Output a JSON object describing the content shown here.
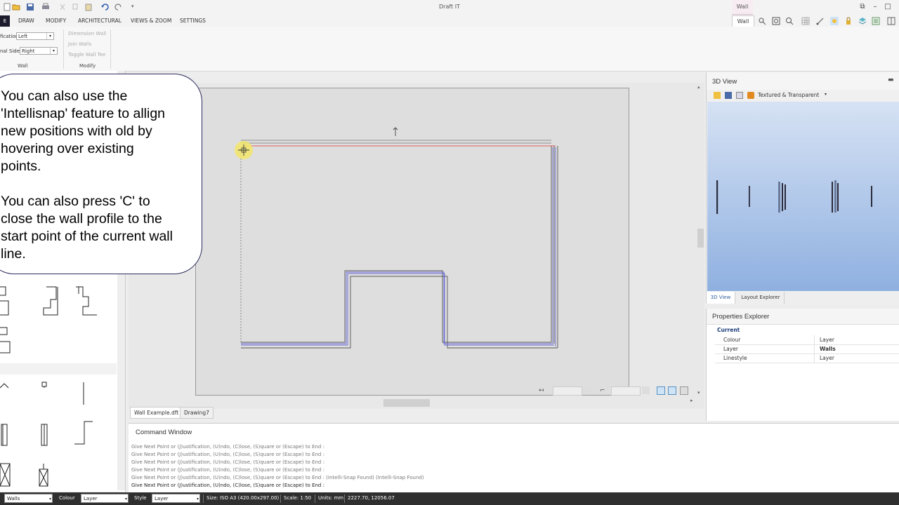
{
  "app": {
    "title": "Draft IT"
  },
  "window_controls": {
    "minimize": "–",
    "maximize": "□",
    "close": "✕",
    "restore_ribbon": "⧉",
    "help": "?"
  },
  "context_tab": {
    "caption": "Wall",
    "tab_label": "Wall"
  },
  "ribbon_tabs": [
    "DRAW",
    "MODIFY",
    "ARCHITECTURAL",
    "VIEWS & ZOOM",
    "SETTINGS"
  ],
  "file_tab": "E",
  "ribbon": {
    "justification_label": "fication",
    "justification_value": "Left",
    "additional_side_label": "nal Side",
    "additional_side_value": "Right",
    "wall_group": "Wall",
    "modify_group": "Modify",
    "modify_items": [
      "Dimension Wall",
      "Join Walls",
      "Toggle Wall Tee"
    ]
  },
  "callout": {
    "para1": "You can also use the\n'Intellisnap' feature to allign\nnew positions with old by\nhovering over existing\npoints.",
    "para2": "You can also press 'C' to\nclose the wall profile to the\nstart point of the current wall\nline."
  },
  "doc_tabs": [
    "Wall Example.dft",
    "Drawing7"
  ],
  "view3d": {
    "title": "3D View",
    "render_mode": "Textured & Transparent",
    "tabs": [
      "3D View",
      "Layout Explorer"
    ],
    "colors": {
      "sky_top": "#c7d8f2",
      "sky_bottom": "#8fb0e0"
    }
  },
  "properties": {
    "title": "Properties Explorer",
    "section": "Current",
    "rows": [
      {
        "name": "Colour",
        "value": "Layer"
      },
      {
        "name": "Layer",
        "value": "Walls"
      },
      {
        "name": "Linestyle",
        "value": "Layer"
      }
    ]
  },
  "command_window": {
    "title": "Command Window",
    "lines": [
      "Give Next Point or (J)ustification, (U)ndo, (C)lose, (S)quare or (Escape) to End :",
      "Give Next Point or (J)ustification, (U)ndo, (C)lose, (S)quare or (Escape) to End :",
      "Give Next Point or (J)ustification, (U)ndo, (C)lose, (S)quare or (Escape) to End :",
      "Give Next Point or (J)ustification, (U)ndo, (C)lose, (S)quare or (Escape) to End :",
      "Give Next Point or (J)ustification, (U)ndo, (C)lose, (S)quare or (Escape) to End :  (Intelli-Snap Found) (Intelli-Snap Found)",
      "Give Next Point or (J)ustification, (U)ndo, (C)lose, (S)quare or (Escape) to End :"
    ]
  },
  "statusbar": {
    "layer": "Walls",
    "colour_label": "Colour",
    "colour_value": "Layer",
    "style_label": "Style",
    "style_value": "Layer",
    "size": "Size: ISO A3 (420.00x297.00)",
    "scale": "Scale: 1:50",
    "units": "Units: mm",
    "coords": "2227.70, 12056.07"
  },
  "colors": {
    "wall_line": "#6b6bd6",
    "guide_red": "#e03030",
    "snap_highlight": "#f2e66a"
  }
}
